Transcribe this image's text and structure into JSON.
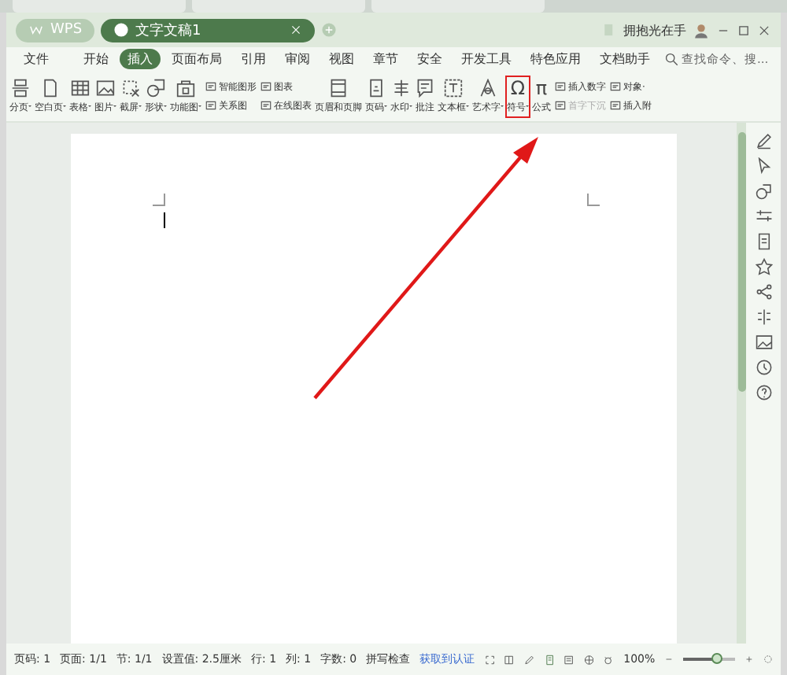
{
  "title_bar": {
    "tabs": [
      {
        "label": "WPS",
        "kind": "home",
        "selected": false
      },
      {
        "label": "文字文稿1",
        "kind": "doc",
        "selected": true
      }
    ],
    "user": "拥抱光在手"
  },
  "menu": {
    "file": "文件",
    "tabs": [
      {
        "label": "开始",
        "selected": false
      },
      {
        "label": "插入",
        "selected": true
      },
      {
        "label": "页面布局",
        "selected": false
      },
      {
        "label": "引用",
        "selected": false
      },
      {
        "label": "审阅",
        "selected": false
      },
      {
        "label": "视图",
        "selected": false
      },
      {
        "label": "章节",
        "selected": false
      },
      {
        "label": "安全",
        "selected": false
      },
      {
        "label": "开发工具",
        "selected": false
      },
      {
        "label": "特色应用",
        "selected": false
      },
      {
        "label": "文档助手",
        "selected": false
      }
    ],
    "search": {
      "placeholder": "查找命令、搜..."
    }
  },
  "ribbon": [
    {
      "kind": "big",
      "label": "分页",
      "dropdown": true,
      "highlighted": false
    },
    {
      "kind": "big",
      "label": "空白页",
      "dropdown": true,
      "highlighted": false
    },
    {
      "kind": "big",
      "label": "表格",
      "dropdown": true,
      "highlighted": false
    },
    {
      "kind": "big",
      "label": "图片",
      "dropdown": true,
      "highlighted": false
    },
    {
      "kind": "big",
      "label": "截屏",
      "dropdown": true,
      "highlighted": false
    },
    {
      "kind": "big",
      "label": "形状",
      "dropdown": true,
      "highlighted": false
    },
    {
      "kind": "big",
      "label": "功能图",
      "dropdown": true,
      "highlighted": false
    },
    {
      "kind": "pair",
      "items": [
        {
          "label": "智能图形",
          "disabled": false
        },
        {
          "label": "关系图",
          "disabled": false
        }
      ]
    },
    {
      "kind": "pair",
      "items": [
        {
          "label": "图表",
          "disabled": false
        },
        {
          "label": "在线图表",
          "disabled": false
        }
      ]
    },
    {
      "kind": "big",
      "label": "页眉和页脚",
      "dropdown": false,
      "highlighted": false
    },
    {
      "kind": "big",
      "label": "页码",
      "dropdown": true,
      "highlighted": false
    },
    {
      "kind": "big",
      "label": "水印",
      "dropdown": true,
      "highlighted": false
    },
    {
      "kind": "big",
      "label": "批注",
      "dropdown": false,
      "highlighted": false
    },
    {
      "kind": "big",
      "label": "文本框",
      "dropdown": true,
      "highlighted": false
    },
    {
      "kind": "big",
      "label": "艺术字",
      "dropdown": true,
      "highlighted": false
    },
    {
      "kind": "big",
      "label": "符号",
      "dropdown": true,
      "highlighted": true,
      "glyph": "Ω"
    },
    {
      "kind": "big",
      "label": "公式",
      "dropdown": false,
      "highlighted": false,
      "glyph": "π"
    },
    {
      "kind": "pair",
      "items": [
        {
          "label": "插入数字",
          "disabled": false
        },
        {
          "label": "首字下沉",
          "disabled": true
        }
      ]
    },
    {
      "kind": "pair",
      "items": [
        {
          "label": "对象·",
          "disabled": false
        },
        {
          "label": "插入附",
          "disabled": false
        }
      ]
    }
  ],
  "status_bar": {
    "items": [
      "页码: 1",
      "页面: 1/1",
      "节: 1/1",
      "设置值: 2.5厘米",
      "行: 1",
      "列: 1",
      "字数: 0"
    ],
    "spell_check": "拼写检查",
    "link": "获取到认证",
    "zoom": "100%",
    "level": 0.65
  }
}
